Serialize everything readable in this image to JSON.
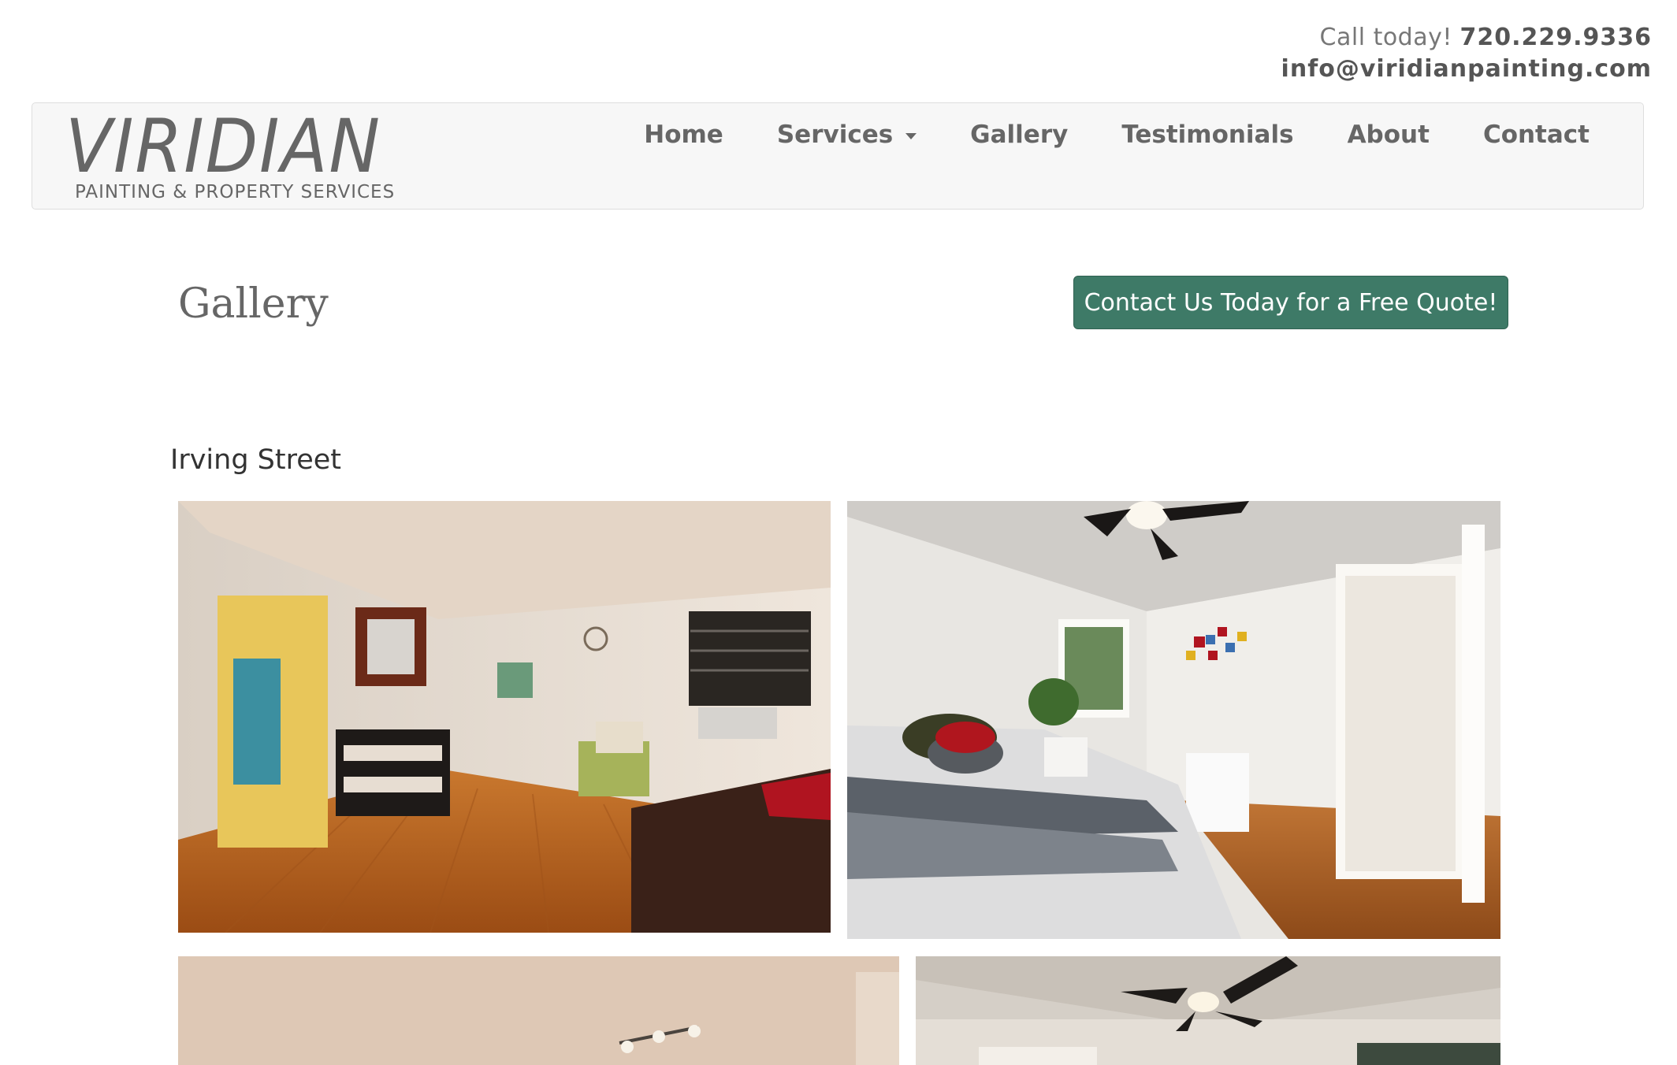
{
  "topbar": {
    "call_label": "Call today!",
    "phone": "720.229.9336",
    "email": "info@viridianpainting.com"
  },
  "logo": {
    "name": "VIRIDIAN",
    "tagline": "PAINTING & PROPERTY SERVICES"
  },
  "nav": {
    "items": [
      {
        "label": "Home"
      },
      {
        "label": "Services",
        "dropdown": true
      },
      {
        "label": "Gallery"
      },
      {
        "label": "Testimonials"
      },
      {
        "label": "About"
      },
      {
        "label": "Contact"
      }
    ]
  },
  "page": {
    "title": "Gallery",
    "cta_label": "Contact Us Today for a Free Quote!"
  },
  "gallery": {
    "section_title": "Irving Street",
    "photos": [
      {
        "subject": "living room with hallway, sofa and hardwood floor"
      },
      {
        "subject": "bedroom with ceiling fan and bed"
      },
      {
        "subject": "room with track lighting"
      },
      {
        "subject": "room with ceiling fan and window"
      }
    ]
  },
  "colors": {
    "accent": "#3e7a67",
    "navbar_bg": "#f7f7f7",
    "text": "#555555"
  }
}
